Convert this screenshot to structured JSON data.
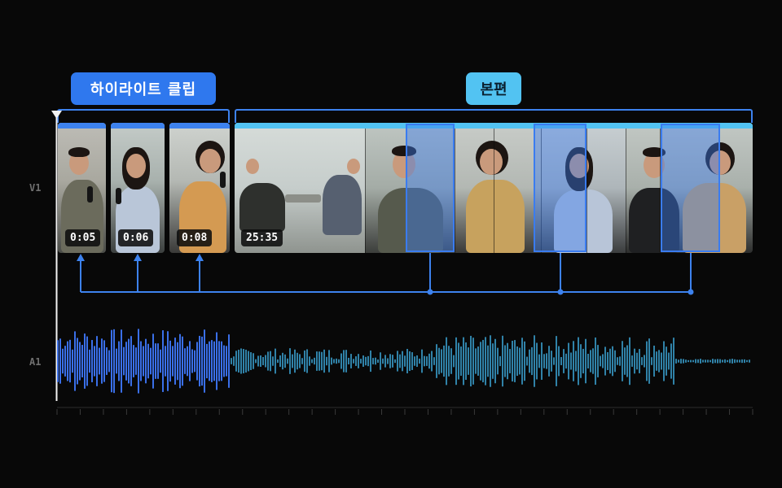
{
  "labels": {
    "highlight": "하이라이트 클립",
    "main": "본편"
  },
  "tracks": {
    "video": "V1",
    "audio": "A1"
  },
  "clips": [
    {
      "duration": "0:05"
    },
    {
      "duration": "0:06"
    },
    {
      "duration": "0:08"
    }
  ],
  "main_clip": {
    "duration": "25:35"
  },
  "colors": {
    "accent_blue": "#2f78ee",
    "accent_cyan": "#52c3f2",
    "connector": "#3d82ee",
    "wave_highlight": "#3a6fe8",
    "wave_main": "#3aa2d0",
    "background": "#080808"
  },
  "icons": {
    "playhead": "playhead-triangle-icon"
  }
}
